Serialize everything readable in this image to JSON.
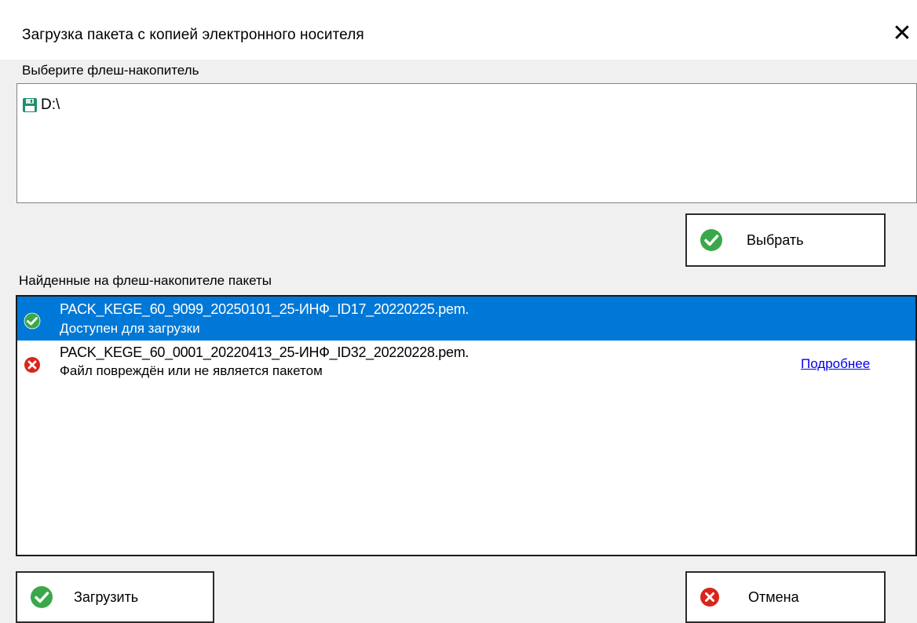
{
  "window": {
    "title": "Загрузка пакета с копией электронного носителя"
  },
  "drive_section": {
    "label": "Выберите флеш-накопитель",
    "items": [
      {
        "label": "D:\\",
        "icon": "floppy-disk-icon"
      }
    ]
  },
  "select_button": {
    "label": "Выбрать",
    "icon": "check-icon"
  },
  "packages_section": {
    "label": "Найденные на флеш-накопителе пакеты",
    "items": [
      {
        "name": "PACK_KEGE_60_9099_20250101_25-ИНФ_ID17_20220225.pem.",
        "status": "Доступен для загрузки",
        "icon": "check-icon",
        "selected": true
      },
      {
        "name": "PACK_KEGE_60_0001_20220413_25-ИНФ_ID32_20220228.pem.",
        "status": "Файл повреждён или не является пакетом",
        "icon": "error-icon",
        "selected": false,
        "link": "Подробнее"
      }
    ]
  },
  "upload_button": {
    "label": "Загрузить",
    "icon": "check-icon"
  },
  "cancel_button": {
    "label": "Отмена",
    "icon": "cancel-icon"
  },
  "colors": {
    "selection": "#0078d7",
    "success": "#3aa84a",
    "error": "#d9261c",
    "link": "#0000ee"
  }
}
